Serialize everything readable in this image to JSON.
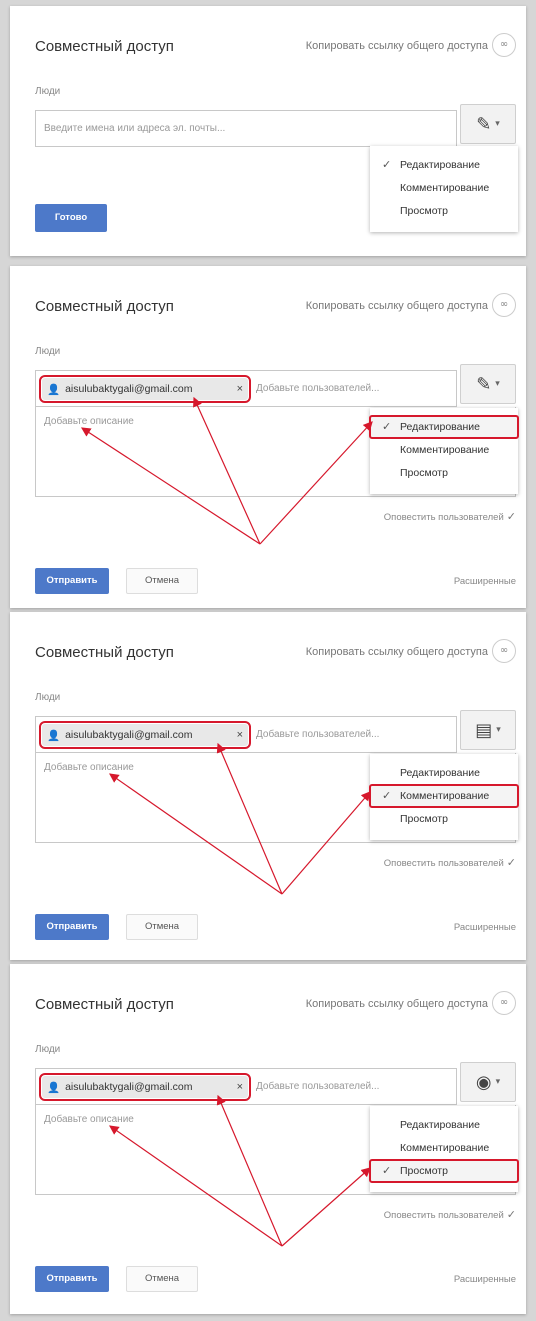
{
  "dialog_title": "Совместный доступ",
  "copy_link_label": "Копировать ссылку общего доступа",
  "link_icon": "link-icon",
  "people_label": "Люди",
  "email_placeholder": "Введите имена или адреса эл. почты...",
  "chip_email": "aisulubaktygali@gmail.com",
  "chip_close": "×",
  "add_users_placeholder": "Добавьте пользователей...",
  "description_placeholder": "Добавьте описание",
  "permission_options": [
    "Редактирование",
    "Комментирование",
    "Просмотр"
  ],
  "check_glyph": "✓",
  "notify_label": "Оповестить пользователей",
  "done_button": "Готово",
  "send_button": "Отправить",
  "cancel_button": "Отмена",
  "advanced_link": "Расширенные",
  "panels": [
    {
      "permission_icon": "pencil-icon",
      "selected": "Редактирование"
    },
    {
      "permission_icon": "pencil-icon",
      "selected": "Редактирование"
    },
    {
      "permission_icon": "comment-icon",
      "selected": "Комментирование"
    },
    {
      "permission_icon": "eye-icon",
      "selected": "Просмотр"
    }
  ],
  "colors": {
    "accent": "#4d79c9",
    "highlight": "#d6182c"
  }
}
